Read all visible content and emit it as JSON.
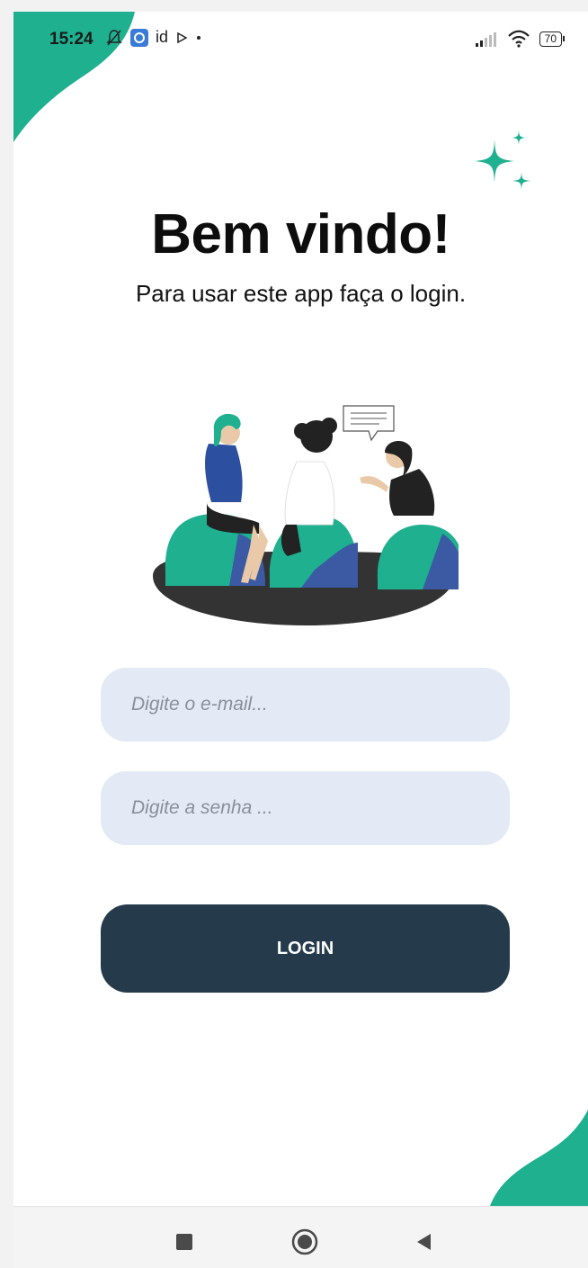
{
  "status_bar": {
    "time": "15:24",
    "app_label": "id",
    "battery": "70"
  },
  "header": {
    "title": "Bem vindo!",
    "subtitle": "Para usar este app faça o login."
  },
  "form": {
    "email_placeholder": "Digite o e-mail...",
    "email_value": "",
    "password_placeholder": "Digite a senha ...",
    "password_value": "",
    "login_label": "LOGIN"
  },
  "icons": {
    "sparkle": "sparkle-icon",
    "illustration": "people-chatting-illustration",
    "nav_recent": "square-icon",
    "nav_home": "circle-icon",
    "nav_back": "triangle-back-icon"
  },
  "colors": {
    "accent": "#1fb08f",
    "button": "#253a4b",
    "input_bg": "#e3eaf5"
  }
}
